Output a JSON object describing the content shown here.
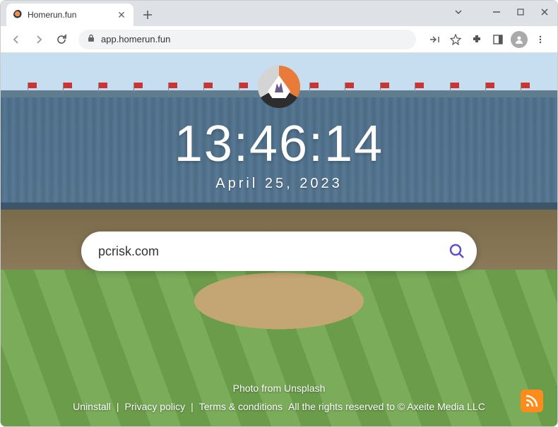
{
  "browser": {
    "tab": {
      "title": "Homerun.fun"
    },
    "url": "app.homerun.fun"
  },
  "page": {
    "clock": "13:46:14",
    "date": "April 25, 2023",
    "search": {
      "value": "pcrisk.com",
      "placeholder": ""
    },
    "footer": {
      "photo_credit": "Photo from Unsplash",
      "links": {
        "uninstall": "Uninstall",
        "privacy": "Privacy policy",
        "terms": "Terms & conditions",
        "copyright": "All the rights reserved to © Axeite Media LLC"
      }
    }
  }
}
